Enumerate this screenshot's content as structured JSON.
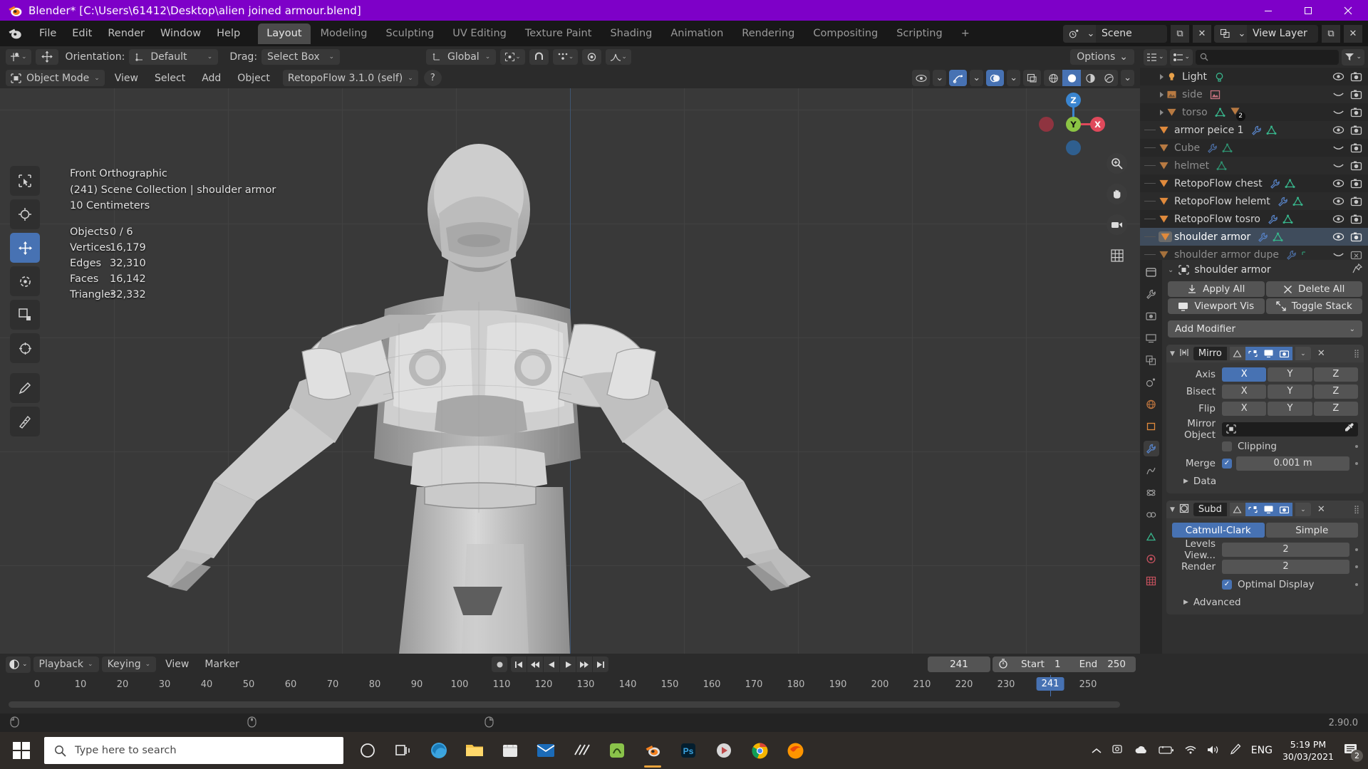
{
  "window": {
    "title": "Blender* [C:\\Users\\61412\\Desktop\\alien joined armour.blend]",
    "minimize": "–",
    "maximize": "❐",
    "close": "✕",
    "accent_color": "#7e00c8"
  },
  "topbar": {
    "menus": [
      "File",
      "Edit",
      "Render",
      "Window",
      "Help"
    ],
    "tabs": [
      {
        "label": "Layout",
        "active": true
      },
      {
        "label": "Modeling",
        "active": false
      },
      {
        "label": "Sculpting",
        "active": false
      },
      {
        "label": "UV Editing",
        "active": false
      },
      {
        "label": "Texture Paint",
        "active": false
      },
      {
        "label": "Shading",
        "active": false
      },
      {
        "label": "Animation",
        "active": false
      },
      {
        "label": "Rendering",
        "active": false
      },
      {
        "label": "Compositing",
        "active": false
      },
      {
        "label": "Scripting",
        "active": false
      },
      {
        "label": "+",
        "active": false
      }
    ],
    "scene_name": "Scene",
    "view_layer_name": "View Layer"
  },
  "tool_settings": {
    "orientation_label": "Orientation:",
    "orientation_value": "Default",
    "drag_label": "Drag:",
    "drag_value": "Select Box",
    "transform_value": "Global",
    "options_label": "Options"
  },
  "viewport": {
    "mode": "Object Mode",
    "menus": [
      "View",
      "Select",
      "Add",
      "Object"
    ],
    "addon_menu": "RetopoFlow 3.1.0 (self)",
    "help_icon": "?",
    "overlay": {
      "view_name": "Front Orthographic",
      "collection_line": "(241) Scene Collection | shoulder armor",
      "grid_scale": "10 Centimeters"
    },
    "stats": [
      {
        "key": "Objects",
        "value": "0 / 6"
      },
      {
        "key": "Vertices",
        "value": "16,179"
      },
      {
        "key": "Edges",
        "value": "32,310"
      },
      {
        "key": "Faces",
        "value": "16,142"
      },
      {
        "key": "Triangles",
        "value": "32,332"
      }
    ],
    "gizmo": {
      "x": "X",
      "y": "Y",
      "z": "Z",
      "color_x": "#e0495b",
      "color_y": "#8bc444",
      "color_z": "#3a85d0"
    }
  },
  "outliner": {
    "search_placeholder": "",
    "rows": [
      {
        "name": "Light",
        "indent": 2,
        "type": "light",
        "dim": false,
        "selected": false,
        "modifier": false,
        "data": true,
        "visible": true,
        "camera": true,
        "count": ""
      },
      {
        "name": "side",
        "indent": 2,
        "type": "image",
        "dim": true,
        "selected": false,
        "modifier": false,
        "data": true,
        "visible": false,
        "camera": true,
        "count": ""
      },
      {
        "name": "torso",
        "indent": 2,
        "type": "mesh",
        "dim": true,
        "selected": false,
        "modifier": false,
        "data": true,
        "visible": false,
        "camera": true,
        "count": "2"
      },
      {
        "name": "armor peice 1",
        "indent": 1,
        "type": "mesh",
        "dim": false,
        "selected": false,
        "modifier": true,
        "data": true,
        "visible": true,
        "camera": true,
        "count": ""
      },
      {
        "name": "Cube",
        "indent": 1,
        "type": "mesh",
        "dim": true,
        "selected": false,
        "modifier": true,
        "data": true,
        "visible": false,
        "camera": true,
        "count": ""
      },
      {
        "name": "helmet",
        "indent": 1,
        "type": "mesh",
        "dim": true,
        "selected": false,
        "modifier": false,
        "data": true,
        "visible": false,
        "camera": true,
        "count": ""
      },
      {
        "name": "RetopoFlow chest",
        "indent": 1,
        "type": "mesh",
        "dim": false,
        "selected": false,
        "modifier": true,
        "data": true,
        "visible": true,
        "camera": true,
        "count": ""
      },
      {
        "name": "RetopoFlow helemt",
        "indent": 1,
        "type": "mesh",
        "dim": false,
        "selected": false,
        "modifier": true,
        "data": true,
        "visible": true,
        "camera": true,
        "count": ""
      },
      {
        "name": "RetopoFlow tosro",
        "indent": 1,
        "type": "mesh",
        "dim": false,
        "selected": false,
        "modifier": true,
        "data": true,
        "visible": true,
        "camera": true,
        "count": ""
      },
      {
        "name": "shoulder armor",
        "indent": 1,
        "type": "mesh",
        "dim": false,
        "selected": true,
        "modifier": true,
        "data": true,
        "visible": true,
        "camera": true,
        "count": ""
      },
      {
        "name": "shoulder armor dupe",
        "indent": 1,
        "type": "mesh",
        "dim": true,
        "selected": false,
        "modifier": true,
        "data": false,
        "visible": false,
        "camera": false,
        "count": ""
      }
    ]
  },
  "properties": {
    "breadcrumb_object": "shoulder armor",
    "buttons": {
      "apply_all": "Apply All",
      "delete_all": "Delete All",
      "viewport_vis": "Viewport Vis",
      "toggle_stack": "Toggle Stack",
      "add_modifier": "Add Modifier"
    },
    "modifiers": [
      {
        "name": "Mirro",
        "type": "mirror",
        "toggles": {
          "edit_cage": false,
          "edit_mode": true,
          "realtime": true,
          "render": true
        },
        "rows": [
          {
            "label": "Axis",
            "options": [
              "X",
              "Y",
              "Z"
            ],
            "selected": [
              "X"
            ]
          },
          {
            "label": "Bisect",
            "options": [
              "X",
              "Y",
              "Z"
            ],
            "selected": []
          },
          {
            "label": "Flip",
            "options": [
              "X",
              "Y",
              "Z"
            ],
            "selected": []
          }
        ],
        "mirror_object_label": "Mirror Object",
        "mirror_object_value": "",
        "clipping_label": "Clipping",
        "clipping_checked": false,
        "merge_label": "Merge",
        "merge_checked": true,
        "merge_value": "0.001 m",
        "data_section": "Data"
      },
      {
        "name": "Subd",
        "type": "subsurf",
        "toggles": {
          "edit_cage": false,
          "edit_mode": true,
          "realtime": true,
          "render": true
        },
        "algo_options": [
          "Catmull-Clark",
          "Simple"
        ],
        "algo_selected": "Catmull-Clark",
        "levels_viewport_label": "Levels View...",
        "levels_viewport_value": "2",
        "render_label": "Render",
        "render_value": "2",
        "optimal_display_label": "Optimal Display",
        "optimal_display_checked": true,
        "advanced_section": "Advanced"
      }
    ]
  },
  "timeline": {
    "menus": [
      {
        "label": "Playback",
        "dropdown": true
      },
      {
        "label": "Keying",
        "dropdown": true
      },
      {
        "label": "View",
        "dropdown": false
      },
      {
        "label": "Marker",
        "dropdown": false
      }
    ],
    "current_frame": "241",
    "start_label": "Start",
    "start_value": "1",
    "end_label": "End",
    "end_value": "250",
    "ticks": [
      0,
      10,
      20,
      30,
      40,
      50,
      60,
      70,
      80,
      90,
      100,
      110,
      120,
      130,
      140,
      150,
      160,
      170,
      180,
      190,
      200,
      210,
      220,
      230,
      250
    ],
    "current_tick": 241
  },
  "status_bar": {
    "version": "2.90.0"
  },
  "taskbar": {
    "search_placeholder": "Type here to search",
    "time": "5:19 PM",
    "date": "30/03/2021",
    "language": "ENG",
    "notification_count": "2"
  },
  "colors": {
    "blender_bg": "#1d1d1d",
    "panel_bg": "#303030",
    "header_bg": "#2b2b2b",
    "viewport_bg": "#393939",
    "accent_blue": "#4772b3",
    "outliner_bg": "#272727",
    "mesh_orange": "#e08a3c"
  }
}
